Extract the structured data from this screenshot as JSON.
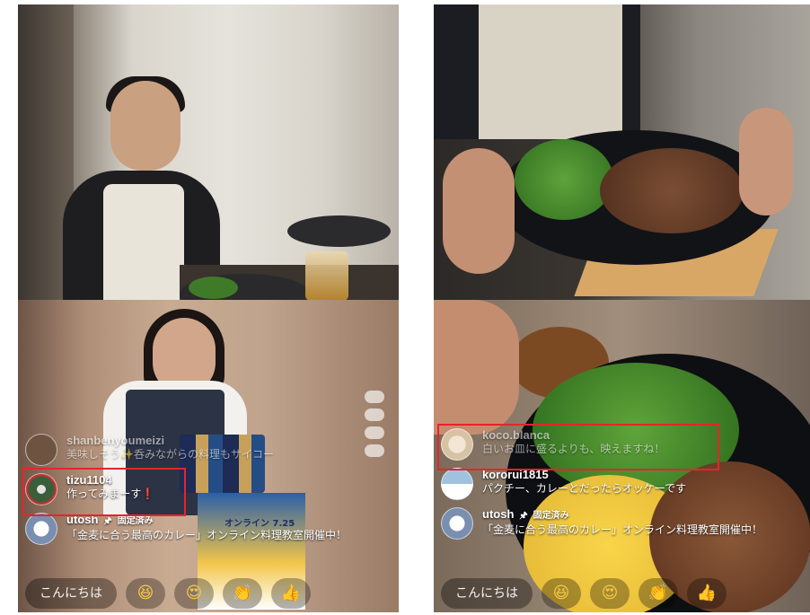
{
  "left": {
    "comments": [
      {
        "user": "shanbenyoumeizi",
        "message": "美味しそう✨呑みながらの料理もサイコー",
        "faded": true,
        "avatar_color": "#6e5340"
      },
      {
        "user": "tizu1104",
        "message": "作ってみまーす❗",
        "faded": false,
        "avatar_color": "#3a5e3a"
      },
      {
        "user": "utosh",
        "pin_label": "固定済み",
        "message": "「金麦に合う最高のカレー」オンライン料理教室開催中！",
        "faded": false,
        "avatar_color": "#7a8fb0"
      }
    ],
    "chat_placeholder": "こんにちは"
  },
  "right": {
    "comments": [
      {
        "user": "koco.blanca",
        "message": "白いお皿に盛るよりも、映えますね！",
        "faded": true,
        "avatar_color": "#d7c2a3"
      },
      {
        "user": "kororui1815",
        "message": "パクチー、カレーとだったらオッケーです",
        "faded": false,
        "avatar_color": "#9fc3de"
      },
      {
        "user": "utosh",
        "pin_label": "固定済み",
        "message": "「金麦に合う最高のカレー」オンライン料理教室開催中！",
        "faded": false,
        "avatar_color": "#7a8fb0"
      }
    ],
    "chat_placeholder": "こんにちは"
  },
  "poster_text": "オンライン 7.25",
  "icons": [
    "laugh-emoji-icon",
    "heart-eyes-emoji-icon",
    "clap-emoji-icon",
    "thumbs-up-emoji-icon",
    "pin-icon"
  ],
  "colors": {
    "highlight": "#e8232b"
  }
}
